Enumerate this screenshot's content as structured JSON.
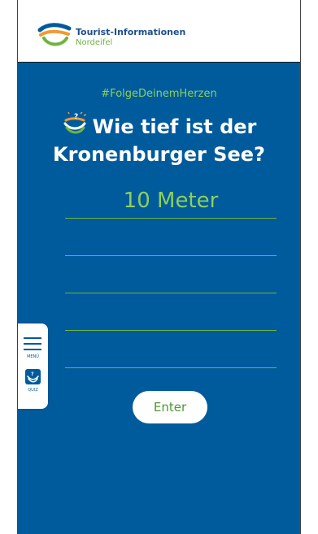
{
  "header": {
    "logo_title": "Tourist-Informationen",
    "logo_subtitle": "Nordeifel"
  },
  "main": {
    "hashtag": "#FolgeDeinemHerzen",
    "question_line1": "Wie tief ist der",
    "question_line2": "Kronenburger See?",
    "answer_value": "10 Meter",
    "enter_label": "Enter"
  },
  "side_panel": {
    "menu_label": "MENÜ",
    "quiz_label": "QUIZ"
  },
  "colors": {
    "brand_blue": "#005b9c",
    "accent_green": "#8cd05a",
    "logo_text_blue": "#1f4e8c",
    "logo_green": "#6fb43f",
    "logo_orange": "#f29a2e"
  },
  "icons": [
    "logo-swoosh-icon",
    "heart-question-icon",
    "hamburger-menu-icon",
    "quiz-icon"
  ]
}
